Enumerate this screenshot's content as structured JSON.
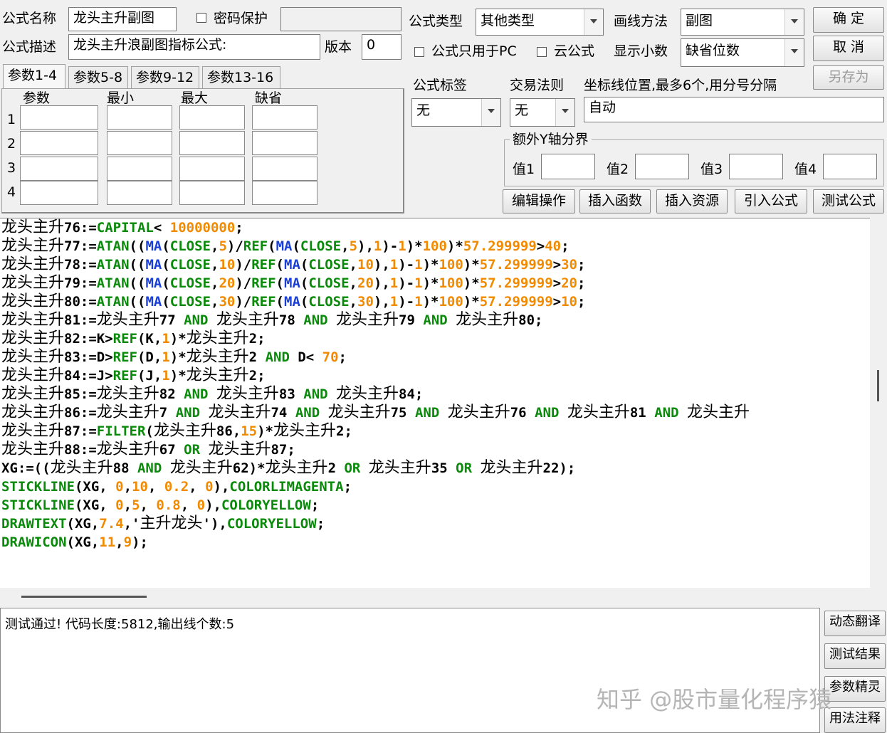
{
  "top": {
    "name_label": "公式名称",
    "name_value": "龙头主升副图",
    "password_label": "密码保护",
    "type_label": "公式类型",
    "type_value": "其他类型",
    "draw_label": "画线方法",
    "draw_value": "副图",
    "ok": "确  定",
    "desc_label": "公式描述",
    "desc_value": "龙头主升浪副图指标公式:",
    "version_label": "版本",
    "version_value": "0",
    "pc_only_label": "公式只用于PC",
    "cloud_label": "云公式",
    "decimal_label": "显示小数",
    "decimal_value": "缺省位数",
    "cancel": "取  消",
    "save_as": "另存为"
  },
  "params": {
    "tabs": [
      "参数1-4",
      "参数5-8",
      "参数9-12",
      "参数13-16"
    ],
    "headers": [
      "参数",
      "最小",
      "最大",
      "缺省"
    ],
    "rows": [
      "1",
      "2",
      "3",
      "4"
    ]
  },
  "right": {
    "tag_label": "公式标签",
    "tag_value": "无",
    "trade_label": "交易法则",
    "trade_value": "无",
    "coord_label": "坐标线位置,最多6个,用分号分隔",
    "coord_value": "自动",
    "yaxis_label": "额外Y轴分界",
    "values": [
      "值1",
      "值2",
      "值3",
      "值4"
    ],
    "buttons": [
      "编辑操作",
      "插入函数",
      "插入资源",
      "引入公式",
      "测试公式"
    ]
  },
  "code_lines": [
    [
      [
        "cn",
        "龙头主升"
      ],
      [
        "b",
        "76:="
      ],
      [
        "f",
        "CAPITAL"
      ],
      [
        "b",
        "< "
      ],
      [
        "n",
        "10000000"
      ],
      [
        "b",
        ";"
      ]
    ],
    [
      [
        "cn",
        "龙头主升"
      ],
      [
        "b",
        "77:="
      ],
      [
        "f",
        "ATAN"
      ],
      [
        "b",
        "(("
      ],
      [
        "m",
        "MA"
      ],
      [
        "b",
        "("
      ],
      [
        "f",
        "CLOSE"
      ],
      [
        "b",
        ","
      ],
      [
        "n",
        "5"
      ],
      [
        "b",
        ")/"
      ],
      [
        "f",
        "REF"
      ],
      [
        "b",
        "("
      ],
      [
        "m",
        "MA"
      ],
      [
        "b",
        "("
      ],
      [
        "f",
        "CLOSE"
      ],
      [
        "b",
        ","
      ],
      [
        "n",
        "5"
      ],
      [
        "b",
        "),"
      ],
      [
        "n",
        "1"
      ],
      [
        "b",
        ")-"
      ],
      [
        "n",
        "1"
      ],
      [
        "b",
        ")*"
      ],
      [
        "n",
        "100"
      ],
      [
        "b",
        ")*"
      ],
      [
        "n",
        "57.299999"
      ],
      [
        "b",
        ">"
      ],
      [
        "n",
        "40"
      ],
      [
        "b",
        ";"
      ]
    ],
    [
      [
        "cn",
        "龙头主升"
      ],
      [
        "b",
        "78:="
      ],
      [
        "f",
        "ATAN"
      ],
      [
        "b",
        "(("
      ],
      [
        "m",
        "MA"
      ],
      [
        "b",
        "("
      ],
      [
        "f",
        "CLOSE"
      ],
      [
        "b",
        ","
      ],
      [
        "n",
        "10"
      ],
      [
        "b",
        ")/"
      ],
      [
        "f",
        "REF"
      ],
      [
        "b",
        "("
      ],
      [
        "m",
        "MA"
      ],
      [
        "b",
        "("
      ],
      [
        "f",
        "CLOSE"
      ],
      [
        "b",
        ","
      ],
      [
        "n",
        "10"
      ],
      [
        "b",
        "),"
      ],
      [
        "n",
        "1"
      ],
      [
        "b",
        ")-"
      ],
      [
        "n",
        "1"
      ],
      [
        "b",
        ")*"
      ],
      [
        "n",
        "100"
      ],
      [
        "b",
        ")*"
      ],
      [
        "n",
        "57.299999"
      ],
      [
        "b",
        ">"
      ],
      [
        "n",
        "30"
      ],
      [
        "b",
        ";"
      ]
    ],
    [
      [
        "cn",
        "龙头主升"
      ],
      [
        "b",
        "79:="
      ],
      [
        "f",
        "ATAN"
      ],
      [
        "b",
        "(("
      ],
      [
        "m",
        "MA"
      ],
      [
        "b",
        "("
      ],
      [
        "f",
        "CLOSE"
      ],
      [
        "b",
        ","
      ],
      [
        "n",
        "20"
      ],
      [
        "b",
        ")/"
      ],
      [
        "f",
        "REF"
      ],
      [
        "b",
        "("
      ],
      [
        "m",
        "MA"
      ],
      [
        "b",
        "("
      ],
      [
        "f",
        "CLOSE"
      ],
      [
        "b",
        ","
      ],
      [
        "n",
        "20"
      ],
      [
        "b",
        "),"
      ],
      [
        "n",
        "1"
      ],
      [
        "b",
        ")-"
      ],
      [
        "n",
        "1"
      ],
      [
        "b",
        ")*"
      ],
      [
        "n",
        "100"
      ],
      [
        "b",
        ")*"
      ],
      [
        "n",
        "57.299999"
      ],
      [
        "b",
        ">"
      ],
      [
        "n",
        "20"
      ],
      [
        "b",
        ";"
      ]
    ],
    [
      [
        "cn",
        "龙头主升"
      ],
      [
        "b",
        "80:="
      ],
      [
        "f",
        "ATAN"
      ],
      [
        "b",
        "(("
      ],
      [
        "m",
        "MA"
      ],
      [
        "b",
        "("
      ],
      [
        "f",
        "CLOSE"
      ],
      [
        "b",
        ","
      ],
      [
        "n",
        "30"
      ],
      [
        "b",
        ")/"
      ],
      [
        "f",
        "REF"
      ],
      [
        "b",
        "("
      ],
      [
        "m",
        "MA"
      ],
      [
        "b",
        "("
      ],
      [
        "f",
        "CLOSE"
      ],
      [
        "b",
        ","
      ],
      [
        "n",
        "30"
      ],
      [
        "b",
        "),"
      ],
      [
        "n",
        "1"
      ],
      [
        "b",
        ")-"
      ],
      [
        "n",
        "1"
      ],
      [
        "b",
        ")*"
      ],
      [
        "n",
        "100"
      ],
      [
        "b",
        ")*"
      ],
      [
        "n",
        "57.299999"
      ],
      [
        "b",
        ">"
      ],
      [
        "n",
        "10"
      ],
      [
        "b",
        ";"
      ]
    ],
    [
      [
        "cn",
        "龙头主升"
      ],
      [
        "b",
        "81:="
      ],
      [
        "cn",
        "龙头主升"
      ],
      [
        "b",
        "77 "
      ],
      [
        "f",
        "AND"
      ],
      [
        "b",
        " "
      ],
      [
        "cn",
        "龙头主升"
      ],
      [
        "b",
        "78 "
      ],
      [
        "f",
        "AND"
      ],
      [
        "b",
        " "
      ],
      [
        "cn",
        "龙头主升"
      ],
      [
        "b",
        "79 "
      ],
      [
        "f",
        "AND"
      ],
      [
        "b",
        " "
      ],
      [
        "cn",
        "龙头主升"
      ],
      [
        "b",
        "80;"
      ]
    ],
    [
      [
        "cn",
        "龙头主升"
      ],
      [
        "b",
        "82:=K>"
      ],
      [
        "f",
        "REF"
      ],
      [
        "b",
        "(K,"
      ],
      [
        "n",
        "1"
      ],
      [
        "b",
        ")*"
      ],
      [
        "cn",
        "龙头主升"
      ],
      [
        "b",
        "2;"
      ]
    ],
    [
      [
        "cn",
        "龙头主升"
      ],
      [
        "b",
        "83:=D>"
      ],
      [
        "f",
        "REF"
      ],
      [
        "b",
        "(D,"
      ],
      [
        "n",
        "1"
      ],
      [
        "b",
        ")*"
      ],
      [
        "cn",
        "龙头主升"
      ],
      [
        "b",
        "2 "
      ],
      [
        "f",
        "AND"
      ],
      [
        "b",
        " D< "
      ],
      [
        "n",
        "70"
      ],
      [
        "b",
        ";"
      ]
    ],
    [
      [
        "cn",
        "龙头主升"
      ],
      [
        "b",
        "84:=J>"
      ],
      [
        "f",
        "REF"
      ],
      [
        "b",
        "(J,"
      ],
      [
        "n",
        "1"
      ],
      [
        "b",
        ")*"
      ],
      [
        "cn",
        "龙头主升"
      ],
      [
        "b",
        "2;"
      ]
    ],
    [
      [
        "cn",
        "龙头主升"
      ],
      [
        "b",
        "85:="
      ],
      [
        "cn",
        "龙头主升"
      ],
      [
        "b",
        "82 "
      ],
      [
        "f",
        "AND"
      ],
      [
        "b",
        " "
      ],
      [
        "cn",
        "龙头主升"
      ],
      [
        "b",
        "83 "
      ],
      [
        "f",
        "AND"
      ],
      [
        "b",
        " "
      ],
      [
        "cn",
        "龙头主升"
      ],
      [
        "b",
        "84;"
      ]
    ],
    [
      [
        "cn",
        "龙头主升"
      ],
      [
        "b",
        "86:="
      ],
      [
        "cn",
        "龙头主升"
      ],
      [
        "b",
        "7 "
      ],
      [
        "f",
        "AND"
      ],
      [
        "b",
        " "
      ],
      [
        "cn",
        "龙头主升"
      ],
      [
        "b",
        "74 "
      ],
      [
        "f",
        "AND"
      ],
      [
        "b",
        " "
      ],
      [
        "cn",
        "龙头主升"
      ],
      [
        "b",
        "75 "
      ],
      [
        "f",
        "AND"
      ],
      [
        "b",
        " "
      ],
      [
        "cn",
        "龙头主升"
      ],
      [
        "b",
        "76 "
      ],
      [
        "f",
        "AND"
      ],
      [
        "b",
        " "
      ],
      [
        "cn",
        "龙头主升"
      ],
      [
        "b",
        "81 "
      ],
      [
        "f",
        "AND"
      ],
      [
        "b",
        " "
      ],
      [
        "cn",
        "龙头主升"
      ]
    ],
    [
      [
        "cn",
        "龙头主升"
      ],
      [
        "b",
        "87:="
      ],
      [
        "f",
        "FILTER"
      ],
      [
        "b",
        "("
      ],
      [
        "cn",
        "龙头主升"
      ],
      [
        "b",
        "86,"
      ],
      [
        "n",
        "15"
      ],
      [
        "b",
        ")*"
      ],
      [
        "cn",
        "龙头主升"
      ],
      [
        "b",
        "2;"
      ]
    ],
    [
      [
        "cn",
        "龙头主升"
      ],
      [
        "b",
        "88:="
      ],
      [
        "cn",
        "龙头主升"
      ],
      [
        "b",
        "67 "
      ],
      [
        "f",
        "OR"
      ],
      [
        "b",
        " "
      ],
      [
        "cn",
        "龙头主升"
      ],
      [
        "b",
        "87;"
      ]
    ],
    [
      [
        "b",
        "XG:=(("
      ],
      [
        "cn",
        "龙头主升"
      ],
      [
        "b",
        "88 "
      ],
      [
        "f",
        "AND"
      ],
      [
        "b",
        " "
      ],
      [
        "cn",
        "龙头主升"
      ],
      [
        "b",
        "62)*"
      ],
      [
        "cn",
        "龙头主升"
      ],
      [
        "b",
        "2 "
      ],
      [
        "f",
        "OR"
      ],
      [
        "b",
        " "
      ],
      [
        "cn",
        "龙头主升"
      ],
      [
        "b",
        "35 "
      ],
      [
        "f",
        "OR"
      ],
      [
        "b",
        " "
      ],
      [
        "cn",
        "龙头主升"
      ],
      [
        "b",
        "22);"
      ]
    ],
    [
      [
        "f",
        "STICKLINE"
      ],
      [
        "b",
        "(XG, "
      ],
      [
        "n",
        "0"
      ],
      [
        "b",
        ","
      ],
      [
        "n",
        "10"
      ],
      [
        "b",
        ", "
      ],
      [
        "n",
        "0.2"
      ],
      [
        "b",
        ", "
      ],
      [
        "n",
        "0"
      ],
      [
        "b",
        "),"
      ],
      [
        "f",
        "COLORLIMAGENTA"
      ],
      [
        "b",
        ";"
      ]
    ],
    [
      [
        "f",
        "STICKLINE"
      ],
      [
        "b",
        "(XG, "
      ],
      [
        "n",
        "0"
      ],
      [
        "b",
        ","
      ],
      [
        "n",
        "5"
      ],
      [
        "b",
        ", "
      ],
      [
        "n",
        "0.8"
      ],
      [
        "b",
        ", "
      ],
      [
        "n",
        "0"
      ],
      [
        "b",
        "),"
      ],
      [
        "f",
        "COLORYELLOW"
      ],
      [
        "b",
        ";"
      ]
    ],
    [
      [
        "f",
        "DRAWTEXT"
      ],
      [
        "b",
        "(XG,"
      ],
      [
        "n",
        "7.4"
      ],
      [
        "b",
        ",'"
      ],
      [
        "cn",
        "主升龙头"
      ],
      [
        "b",
        "'),"
      ],
      [
        "f",
        "COLORYELLOW"
      ],
      [
        "b",
        ";"
      ]
    ],
    [
      [
        "f",
        "DRAWICON"
      ],
      [
        "b",
        "(XG,"
      ],
      [
        "n",
        "11"
      ],
      [
        "b",
        ","
      ],
      [
        "n",
        "9"
      ],
      [
        "b",
        ");"
      ]
    ]
  ],
  "status": "测试通过! 代码长度:5812,输出线个数:5",
  "side_buttons": [
    "动态翻译",
    "测试结果",
    "参数精灵",
    "用法注释"
  ],
  "watermark": "知乎 @股市量化程序猿"
}
